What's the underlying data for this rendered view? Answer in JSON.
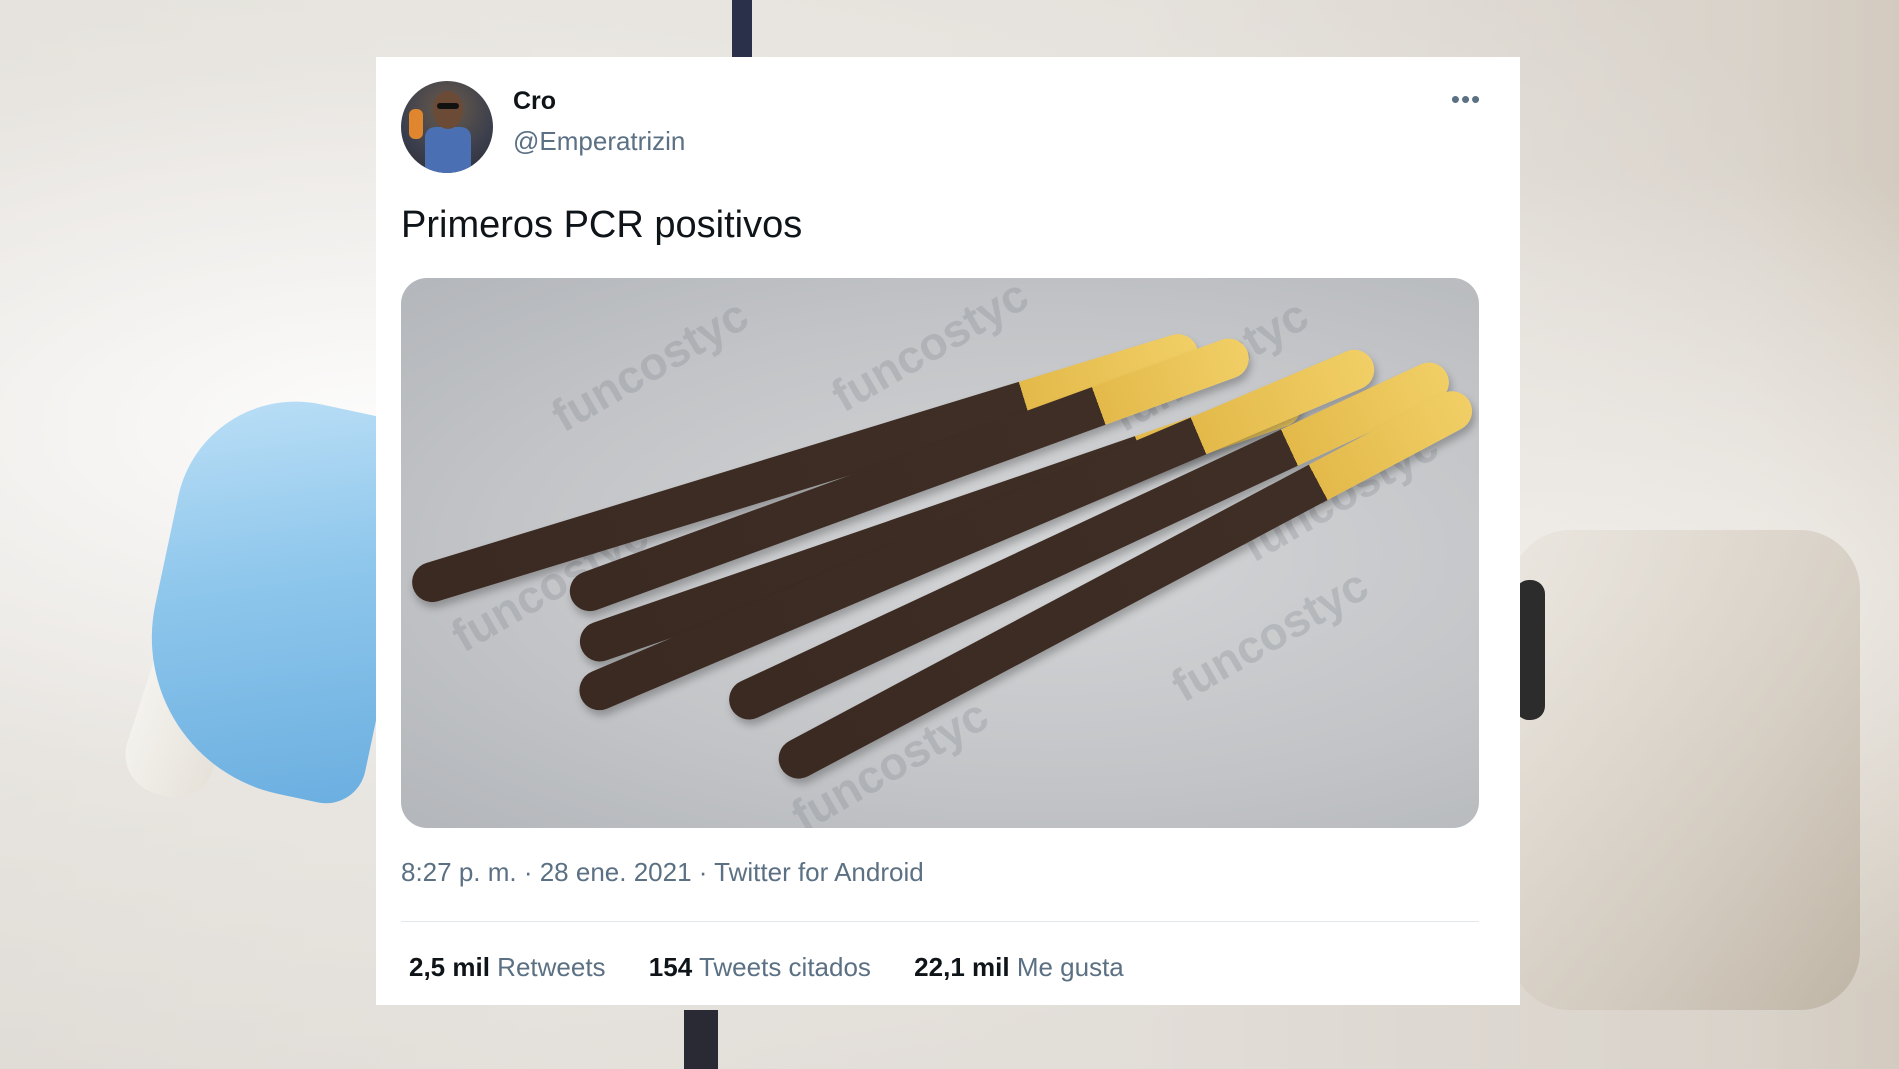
{
  "tweet": {
    "name": "Cro",
    "handle": "@Emperatrizin",
    "more_icon": "more-icon",
    "text": "Primeros PCR positivos",
    "meta": "8:27 p. m. · 28 ene. 2021 · Twitter for Android",
    "stats": [
      {
        "count": "2,5 mil",
        "label": "Retweets"
      },
      {
        "count": "154",
        "label": "Tweets citados"
      },
      {
        "count": "22,1 mil",
        "label": "Me gusta"
      }
    ],
    "media_watermark": "funcostyc"
  },
  "colors": {
    "text_primary": "#0f1419",
    "text_secondary": "#5b7083",
    "divider": "#e1e8ed",
    "glove": "#8fc7ec"
  }
}
